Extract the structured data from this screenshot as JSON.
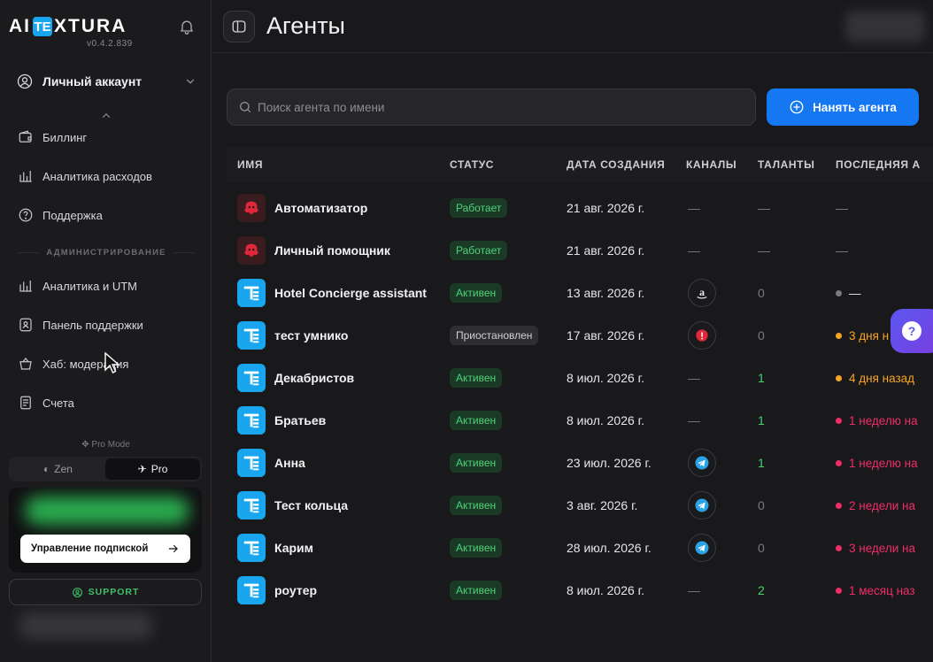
{
  "app": {
    "logo_left": "AI",
    "logo_box": "TE",
    "logo_right": "XTURA",
    "version": "v0.4.2.839"
  },
  "sidebar": {
    "account_label": "Личный аккаунт",
    "items": [
      {
        "label": "Биллинг",
        "icon": "wallet-icon"
      },
      {
        "label": "Аналитика расходов",
        "icon": "bar-chart-icon"
      },
      {
        "label": "Поддержка",
        "icon": "help-circle-icon"
      }
    ],
    "admin_section": "АДМИНИСТРИРОВАНИЕ",
    "admin_items": [
      {
        "label": "Аналитика и UTM",
        "icon": "bar-chart-icon"
      },
      {
        "label": "Панель поддержки",
        "icon": "user-shield-icon"
      },
      {
        "label": "Хаб: модерация",
        "icon": "basket-icon"
      },
      {
        "label": "Счета",
        "icon": "invoice-icon"
      }
    ],
    "pro_mode_label": "Pro Mode",
    "mode_zen": "Zen",
    "mode_pro": "Pro",
    "manage_subscription": "Управление подпиской",
    "support": "SUPPORT"
  },
  "header": {
    "title": "Агенты"
  },
  "search": {
    "placeholder": "Поиск агента по имени"
  },
  "hire_button": "Нанять агента",
  "table": {
    "columns": [
      "ИМЯ",
      "СТАТУС",
      "ДАТА СОЗДАНИЯ",
      "КАНАЛЫ",
      "ТАЛАНТЫ",
      "ПОСЛЕДНЯЯ А"
    ],
    "rows": [
      {
        "name": "Автоматизатор",
        "avatar": "red",
        "status": "Работает",
        "status_color": "green",
        "date": "21 авг. 2026 г.",
        "channel": "—",
        "talents": "—",
        "last": "—",
        "last_color": ""
      },
      {
        "name": "Личный помощник",
        "avatar": "red",
        "status": "Работает",
        "status_color": "green",
        "date": "21 авг. 2026 г.",
        "channel": "—",
        "talents": "—",
        "last": "—",
        "last_color": ""
      },
      {
        "name": "Hotel Concierge assistant",
        "avatar": "te",
        "status": "Активен",
        "status_color": "green",
        "date": "13 авг. 2026 г.",
        "channel": "amazon",
        "talents": "0",
        "last": "—",
        "last_color": "#7a7a80"
      },
      {
        "name": "тест умнико",
        "avatar": "te",
        "status": "Приостановлен",
        "status_color": "gray",
        "date": "17 авг. 2026 г.",
        "channel": "red",
        "talents": "0",
        "last": "3 дня н",
        "last_color": "#f5a623"
      },
      {
        "name": "Декабристов",
        "avatar": "te",
        "status": "Активен",
        "status_color": "green",
        "date": "8 июл. 2026 г.",
        "channel": "—",
        "talents": "1",
        "last": "4 дня назад",
        "last_color": "#f5a623"
      },
      {
        "name": "Братьев",
        "avatar": "te",
        "status": "Активен",
        "status_color": "green",
        "date": "8 июл. 2026 г.",
        "channel": "—",
        "talents": "1",
        "last": "1 неделю на",
        "last_color": "#ef2d6a"
      },
      {
        "name": "Анна",
        "avatar": "te",
        "status": "Активен",
        "status_color": "green",
        "date": "23 июл. 2026 г.",
        "channel": "telegram",
        "talents": "1",
        "last": "1 неделю на",
        "last_color": "#ef2d6a"
      },
      {
        "name": "Тест кольца",
        "avatar": "te",
        "status": "Активен",
        "status_color": "green",
        "date": "3 авг. 2026 г.",
        "channel": "telegram",
        "talents": "0",
        "last": "2 недели на",
        "last_color": "#ef2d6a"
      },
      {
        "name": "Карим",
        "avatar": "te",
        "status": "Активен",
        "status_color": "green",
        "date": "28 июл. 2026 г.",
        "channel": "telegram",
        "talents": "0",
        "last": "3 недели на",
        "last_color": "#ef2d6a"
      },
      {
        "name": "роутер",
        "avatar": "te",
        "status": "Активен",
        "status_color": "green",
        "date": "8 июл. 2026 г.",
        "channel": "—",
        "talents": "2",
        "last": "1 месяц наз",
        "last_color": "#ef2d6a"
      }
    ]
  },
  "help_fab": "?"
}
